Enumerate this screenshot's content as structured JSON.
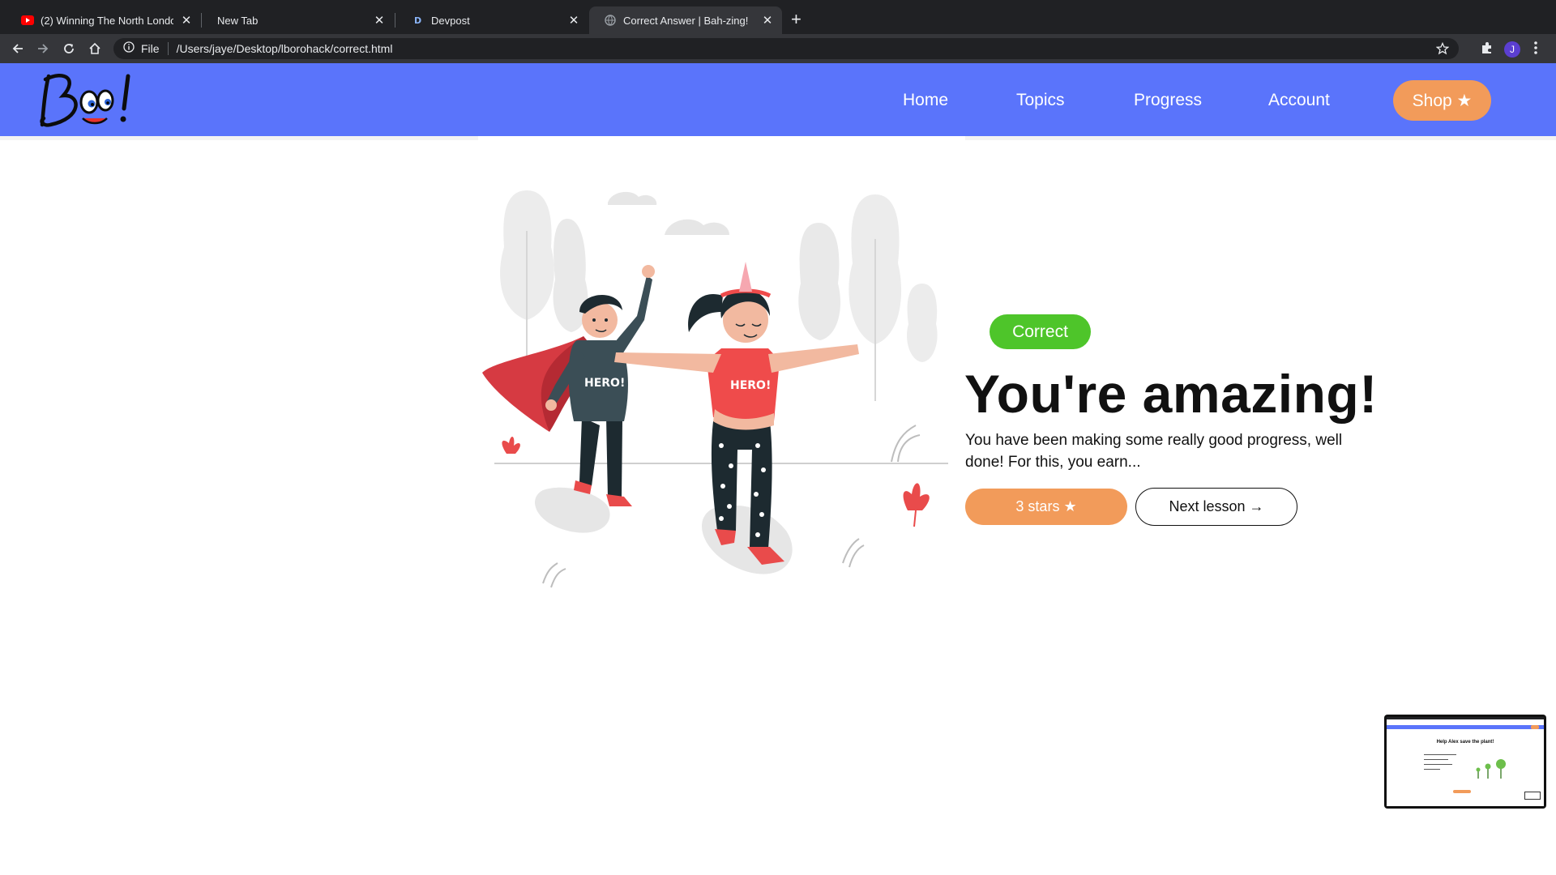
{
  "browser": {
    "tabs": [
      {
        "title": "(2) Winning The North London",
        "favicon": "youtube-icon",
        "active": false
      },
      {
        "title": "New Tab",
        "favicon": "",
        "active": false
      },
      {
        "title": "Devpost",
        "favicon": "devpost-icon",
        "active": false
      },
      {
        "title": "Correct Answer | Bah-zing!",
        "favicon": "globe-icon",
        "active": true
      }
    ],
    "new_tab_label": "+",
    "omnibox": {
      "scheme_label": "File",
      "url": "/Users/jaye/Desktop/lborohack/correct.html"
    },
    "profile_initial": "J"
  },
  "site": {
    "logo_text": "Boo!",
    "nav": {
      "home": "Home",
      "topics": "Topics",
      "progress": "Progress",
      "account": "Account",
      "shop": "Shop ★"
    }
  },
  "main": {
    "badge": "Correct",
    "headline": "You're amazing!",
    "message": "You have been making some really good progress, well done! For this, you earn...",
    "reward_button": "3 stars ★",
    "next_button": "Next lesson →",
    "illustration": {
      "boy_shirt_text": "HERO!",
      "girl_shirt_text": "HERO!"
    }
  },
  "pip_preview": {
    "title": "Help Alex save the plant!"
  },
  "colors": {
    "brand_blue": "#5a74fb",
    "accent_orange": "#f29b5a",
    "success_green": "#4ec52a"
  }
}
